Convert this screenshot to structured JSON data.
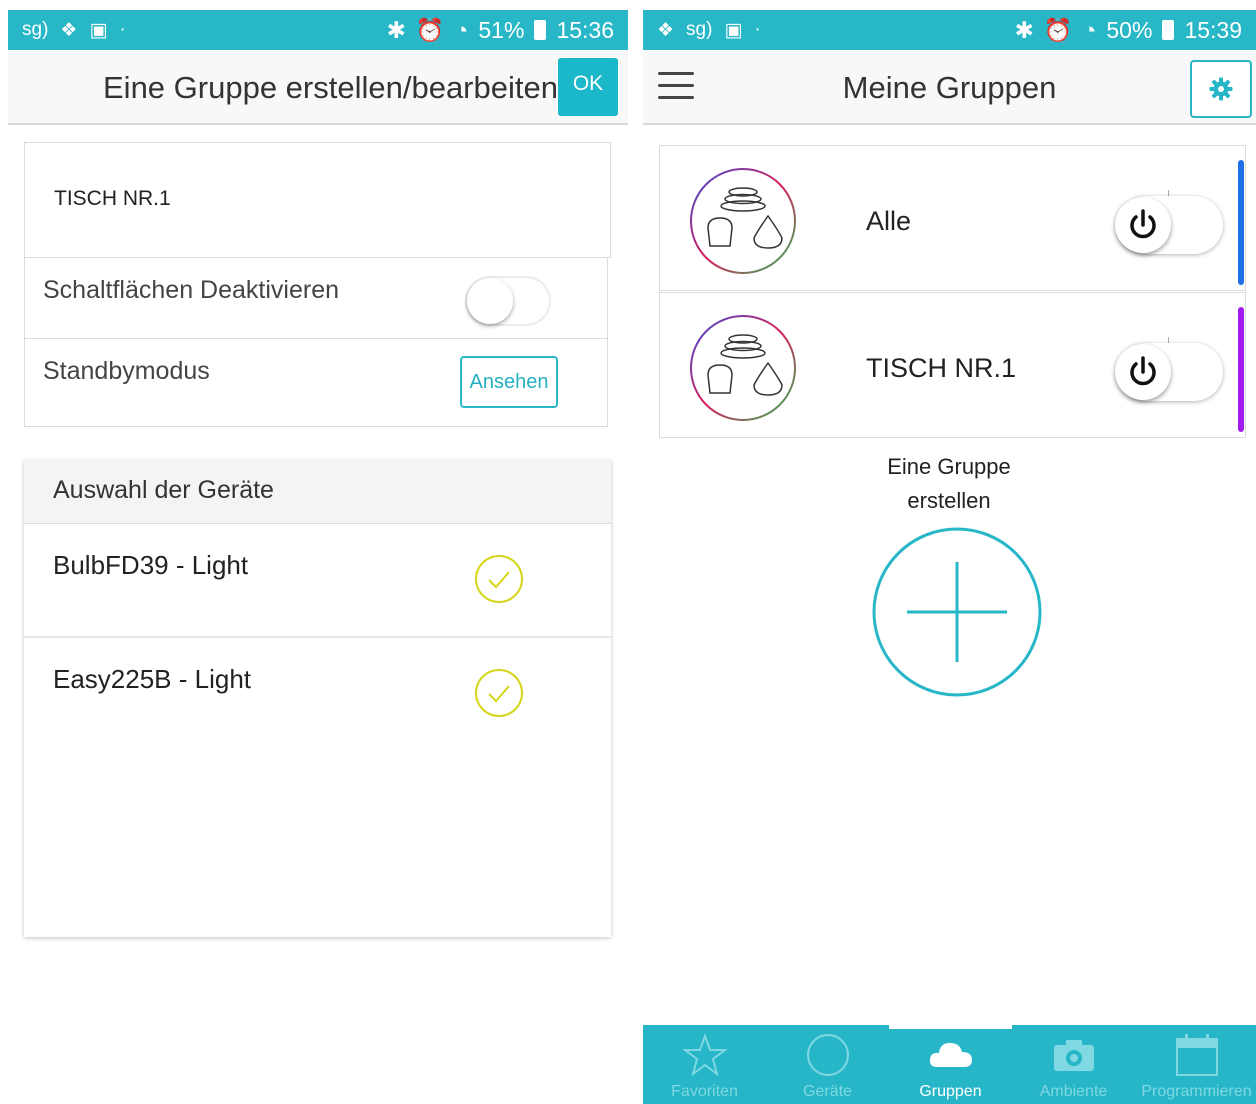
{
  "colors": {
    "accent": "#27b7c7",
    "check": "#d4d61a",
    "group_bar_alle": "#1e6ee8",
    "group_bar_tisch": "#a21cf2"
  },
  "left": {
    "status": {
      "percent": "51%",
      "time": "15:36"
    },
    "header": {
      "title": "Eine Gruppe erstellen/bearbeiten",
      "ok_label": "OK"
    },
    "group_name": "TISCH NR.1",
    "settings": {
      "disable_label": "Schaltflächen Deaktivieren",
      "disable_on": false,
      "standby_label": "Standbymodus",
      "view_label": "Ansehen"
    },
    "devices": {
      "header": "Auswahl der Geräte",
      "items": [
        {
          "name": "BulbFD39 - Light",
          "selected": true
        },
        {
          "name": "Easy225B - Light",
          "selected": true
        }
      ]
    }
  },
  "right": {
    "status": {
      "percent": "50%",
      "time": "15:39"
    },
    "header": {
      "title": "Meine Gruppen"
    },
    "groups": [
      {
        "name": "Alle",
        "on": false
      },
      {
        "name": "TISCH NR.1",
        "on": false
      }
    ],
    "create": {
      "line1": "Eine Gruppe",
      "line2": "erstellen"
    },
    "nav": [
      {
        "label": "Favoriten",
        "icon": "star-icon",
        "active": false
      },
      {
        "label": "Geräte",
        "icon": "circle-icon",
        "active": false
      },
      {
        "label": "Gruppen",
        "icon": "cloud-icon",
        "active": true
      },
      {
        "label": "Ambiente",
        "icon": "camera-icon",
        "active": false
      },
      {
        "label": "Programmieren",
        "icon": "calendar-icon",
        "active": false
      }
    ]
  }
}
